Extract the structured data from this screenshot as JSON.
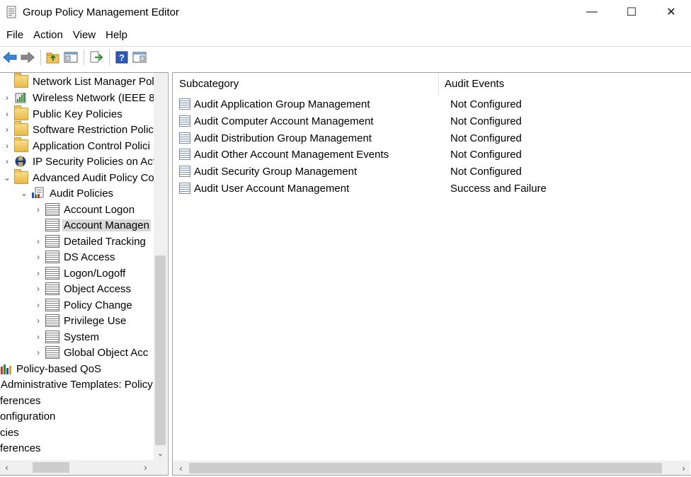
{
  "window": {
    "title": "Group Policy Management Editor",
    "controls": {
      "minimize": "—",
      "maximize": "☐",
      "close": "✕"
    }
  },
  "menu": [
    "File",
    "Action",
    "View",
    "Help"
  ],
  "toolbar": {
    "buttons": [
      "back-icon",
      "forward-icon",
      "up-folder-icon",
      "show-hide-tree-icon",
      "export-list-icon",
      "help-icon",
      "properties-pane-icon"
    ]
  },
  "tree": {
    "rows": [
      {
        "label": "Network List Manager Pol",
        "icon": "folder-icon",
        "expander": ""
      },
      {
        "label": "Wireless Network (IEEE 80",
        "icon": "wireless-icon",
        "expander": "›"
      },
      {
        "label": "Public Key Policies",
        "icon": "folder-icon",
        "expander": "›"
      },
      {
        "label": "Software Restriction Polic",
        "icon": "folder-icon",
        "expander": "›"
      },
      {
        "label": "Application Control Polici",
        "icon": "folder-icon",
        "expander": "›"
      },
      {
        "label": "IP Security Policies on Act",
        "icon": "ipsec-icon",
        "expander": "›"
      },
      {
        "label": "Advanced Audit Policy Co",
        "icon": "folder-icon",
        "expander": "⌄"
      },
      {
        "label": "Audit Policies",
        "icon": "audit-policies-icon",
        "expander": "⌄"
      },
      {
        "label": "Account Logon",
        "icon": "policy-icon",
        "expander": "›"
      },
      {
        "label": "Account Managen",
        "icon": "policy-icon",
        "expander": ""
      },
      {
        "label": "Detailed Tracking",
        "icon": "policy-icon",
        "expander": "›"
      },
      {
        "label": "DS Access",
        "icon": "policy-icon",
        "expander": "›"
      },
      {
        "label": "Logon/Logoff",
        "icon": "policy-icon",
        "expander": "›"
      },
      {
        "label": "Object Access",
        "icon": "policy-icon",
        "expander": "›"
      },
      {
        "label": "Policy Change",
        "icon": "policy-icon",
        "expander": "›"
      },
      {
        "label": "Privilege Use",
        "icon": "policy-icon",
        "expander": "›"
      },
      {
        "label": "System",
        "icon": "policy-icon",
        "expander": "›"
      },
      {
        "label": "Global Object Acc",
        "icon": "policy-icon",
        "expander": "›"
      },
      {
        "label": "Policy-based QoS",
        "icon": "qos-chart-icon",
        "expander": ""
      },
      {
        "label": "Administrative Templates: Policy",
        "icon": "",
        "expander": ""
      },
      {
        "label": "ferences",
        "icon": "",
        "expander": ""
      },
      {
        "label": "onfiguration",
        "icon": "",
        "expander": ""
      },
      {
        "label": "cies",
        "icon": "",
        "expander": ""
      },
      {
        "label": "ferences",
        "icon": "",
        "expander": ""
      }
    ]
  },
  "list": {
    "columns": [
      "Subcategory",
      "Audit Events"
    ],
    "rows": [
      {
        "subcategory": "Audit Application Group Management",
        "events": "Not Configured"
      },
      {
        "subcategory": "Audit Computer Account Management",
        "events": "Not Configured"
      },
      {
        "subcategory": "Audit Distribution Group Management",
        "events": "Not Configured"
      },
      {
        "subcategory": "Audit Other Account Management Events",
        "events": "Not Configured"
      },
      {
        "subcategory": "Audit Security Group Management",
        "events": "Not Configured"
      },
      {
        "subcategory": "Audit User Account Management",
        "events": "Success and Failure"
      }
    ]
  },
  "scroll": {
    "left": "‹",
    "right": "›",
    "down": "⌄"
  }
}
